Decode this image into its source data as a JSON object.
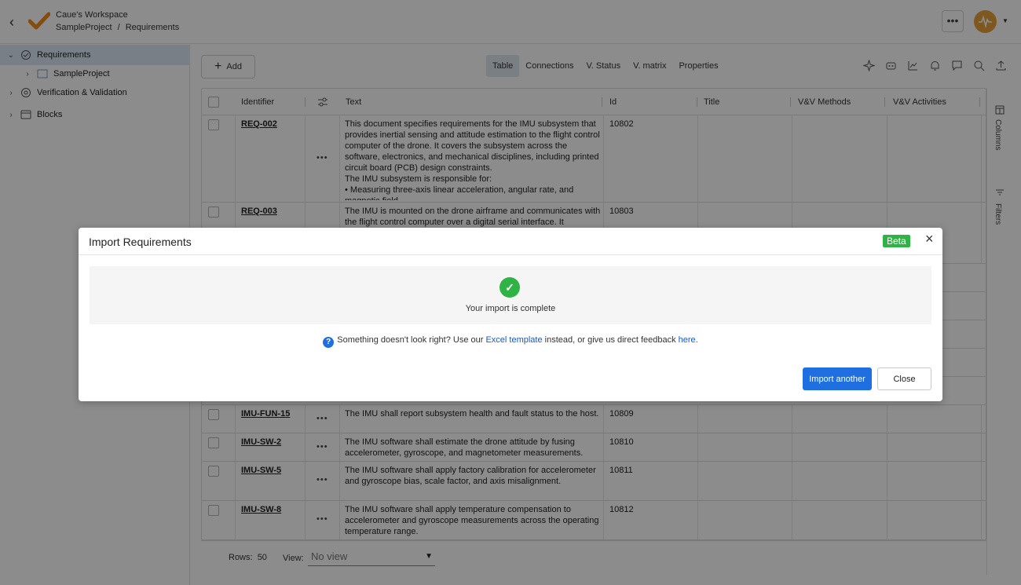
{
  "header": {
    "workspace": "Caue's Workspace",
    "breadcrumb": [
      "SampleProject",
      "/",
      "Requirements"
    ],
    "more_label": "•••"
  },
  "sidebar": {
    "items": [
      {
        "label": "Requirements",
        "icon": "requirements-icon"
      },
      {
        "label": "SampleProject",
        "icon": "project-icon"
      },
      {
        "label": "Verification & Validation",
        "icon": "vv-icon"
      },
      {
        "label": "Blocks",
        "icon": "blocks-icon"
      }
    ]
  },
  "toolbar": {
    "add_label": "Add",
    "tabs": [
      "Table",
      "Connections",
      "V. Status",
      "V. matrix",
      "Properties"
    ],
    "active_tab": "Table",
    "tool_icons": [
      "sparkle-icon",
      "robot-icon",
      "chart-icon",
      "bell-icon",
      "comment-icon",
      "search-icon",
      "upload-icon"
    ]
  },
  "table": {
    "columns": [
      "Identifier",
      "Text",
      "Id",
      "Title",
      "V&V Methods",
      "V&V Activities"
    ],
    "rows": [
      {
        "identifier": "REQ-002",
        "text": "This document specifies requirements for the IMU subsystem that provides inertial sensing and attitude estimation to the flight control computer of the drone. It covers the subsystem across the software, electronics, and mechanical disciplines, including printed circuit board (PCB) design constraints.\nThe IMU subsystem is responsible for:\n• Measuring three-axis linear acceleration, angular rate, and magnetic field",
        "id": "10802"
      },
      {
        "identifier": "REQ-003",
        "text": "The IMU is mounted on the drone airframe and communicates with the flight control computer over a digital serial interface. It",
        "id": "10803"
      },
      {
        "identifier": "IMU-FUN-15",
        "text": "The IMU shall report subsystem health and fault status to the host.",
        "id": "10809"
      },
      {
        "identifier": "IMU-SW-2",
        "text": "The IMU software shall estimate the drone attitude by fusing accelerometer, gyroscope, and magnetometer measurements.",
        "id": "10810"
      },
      {
        "identifier": "IMU-SW-5",
        "text": "The IMU software shall apply factory calibration for accelerometer and gyroscope bias, scale factor, and axis misalignment.",
        "id": "10811"
      },
      {
        "identifier": "IMU-SW-8",
        "text": "The IMU software shall apply temperature compensation to accelerometer and gyroscope measurements across the operating temperature range.",
        "id": "10812"
      }
    ],
    "row_menu_label": "•••"
  },
  "footer": {
    "rows_label": "Rows:",
    "rows_value": "50",
    "view_label": "View:",
    "view_value": "No view"
  },
  "side_panel": {
    "columns_label": "Columns",
    "filters_label": "Filters"
  },
  "modal": {
    "title": "Import Requirements",
    "badge": "Beta",
    "success_message": "Your import is complete",
    "feedback_prefix": "Something doesn't look right? Use our ",
    "feedback_link1": "Excel template",
    "feedback_middle": " instead, or give us direct feedback ",
    "feedback_link2": "here",
    "feedback_suffix": ".",
    "primary_button": "Import another",
    "secondary_button": "Close"
  },
  "colors": {
    "accent": "#1f6fe0",
    "success": "#2fb344",
    "active_tab_bg": "#dfe7f0",
    "sidebar_active_bg": "#dce8f6",
    "logo_orange": "#f08a1c"
  }
}
